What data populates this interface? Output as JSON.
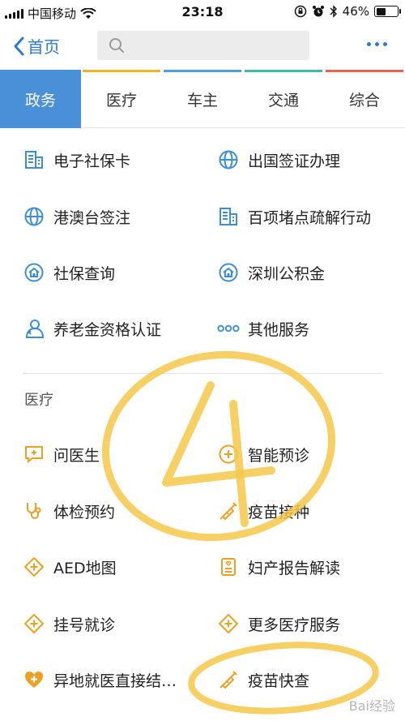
{
  "status_bar": {
    "carrier": "中国移动",
    "time": "23:18",
    "battery": "46%",
    "battery_fraction": 0.46
  },
  "nav": {
    "back_label": "首页",
    "search_placeholder": ""
  },
  "tabs": [
    {
      "label": "政务",
      "accent": "#4a90d9"
    },
    {
      "label": "医疗",
      "accent": "#f0b429"
    },
    {
      "label": "车主",
      "accent": "#4aa3df"
    },
    {
      "label": "交通",
      "accent": "#3fb8af"
    },
    {
      "label": "综合",
      "accent": "#e8634a"
    }
  ],
  "gov_services": [
    {
      "label": "电子社保卡",
      "icon": "building-icon"
    },
    {
      "label": "出国签证办理",
      "icon": "globe-icon"
    },
    {
      "label": "港澳台签注",
      "icon": "globe-icon"
    },
    {
      "label": "百项堵点疏解行动",
      "icon": "building-icon"
    },
    {
      "label": "社保查询",
      "icon": "house-icon"
    },
    {
      "label": "深圳公积金",
      "icon": "house-icon"
    },
    {
      "label": "养老金资格认证",
      "icon": "person-icon"
    },
    {
      "label": "其他服务",
      "icon": "dots-icon"
    }
  ],
  "medical_section": {
    "title": "医疗",
    "items": [
      {
        "label": "问医生",
        "icon": "chat-plus-icon"
      },
      {
        "label": "智能预诊",
        "icon": "circle-plus-icon"
      },
      {
        "label": "体检预约",
        "icon": "stethoscope-icon"
      },
      {
        "label": "疫苗接种",
        "icon": "syringe-icon"
      },
      {
        "label": "AED地图",
        "icon": "diamond-plus-icon"
      },
      {
        "label": "妇产报告解读",
        "icon": "report-icon"
      },
      {
        "label": "挂号就诊",
        "icon": "diamond-plus-icon"
      },
      {
        "label": "更多医疗服务",
        "icon": "diamond-plus-icon"
      },
      {
        "label": "异地就医直接结…",
        "icon": "heart-plus-icon"
      },
      {
        "label": "疫苗快查",
        "icon": "syringe-icon"
      }
    ]
  },
  "colors": {
    "blue_accent": "#2a7bd6",
    "gov_icon": "#3a8fd6",
    "medical_icon": "#f0a020",
    "annotation": "#f4c84a"
  },
  "annotation": {
    "number": "4"
  },
  "watermark": "Bai经验"
}
